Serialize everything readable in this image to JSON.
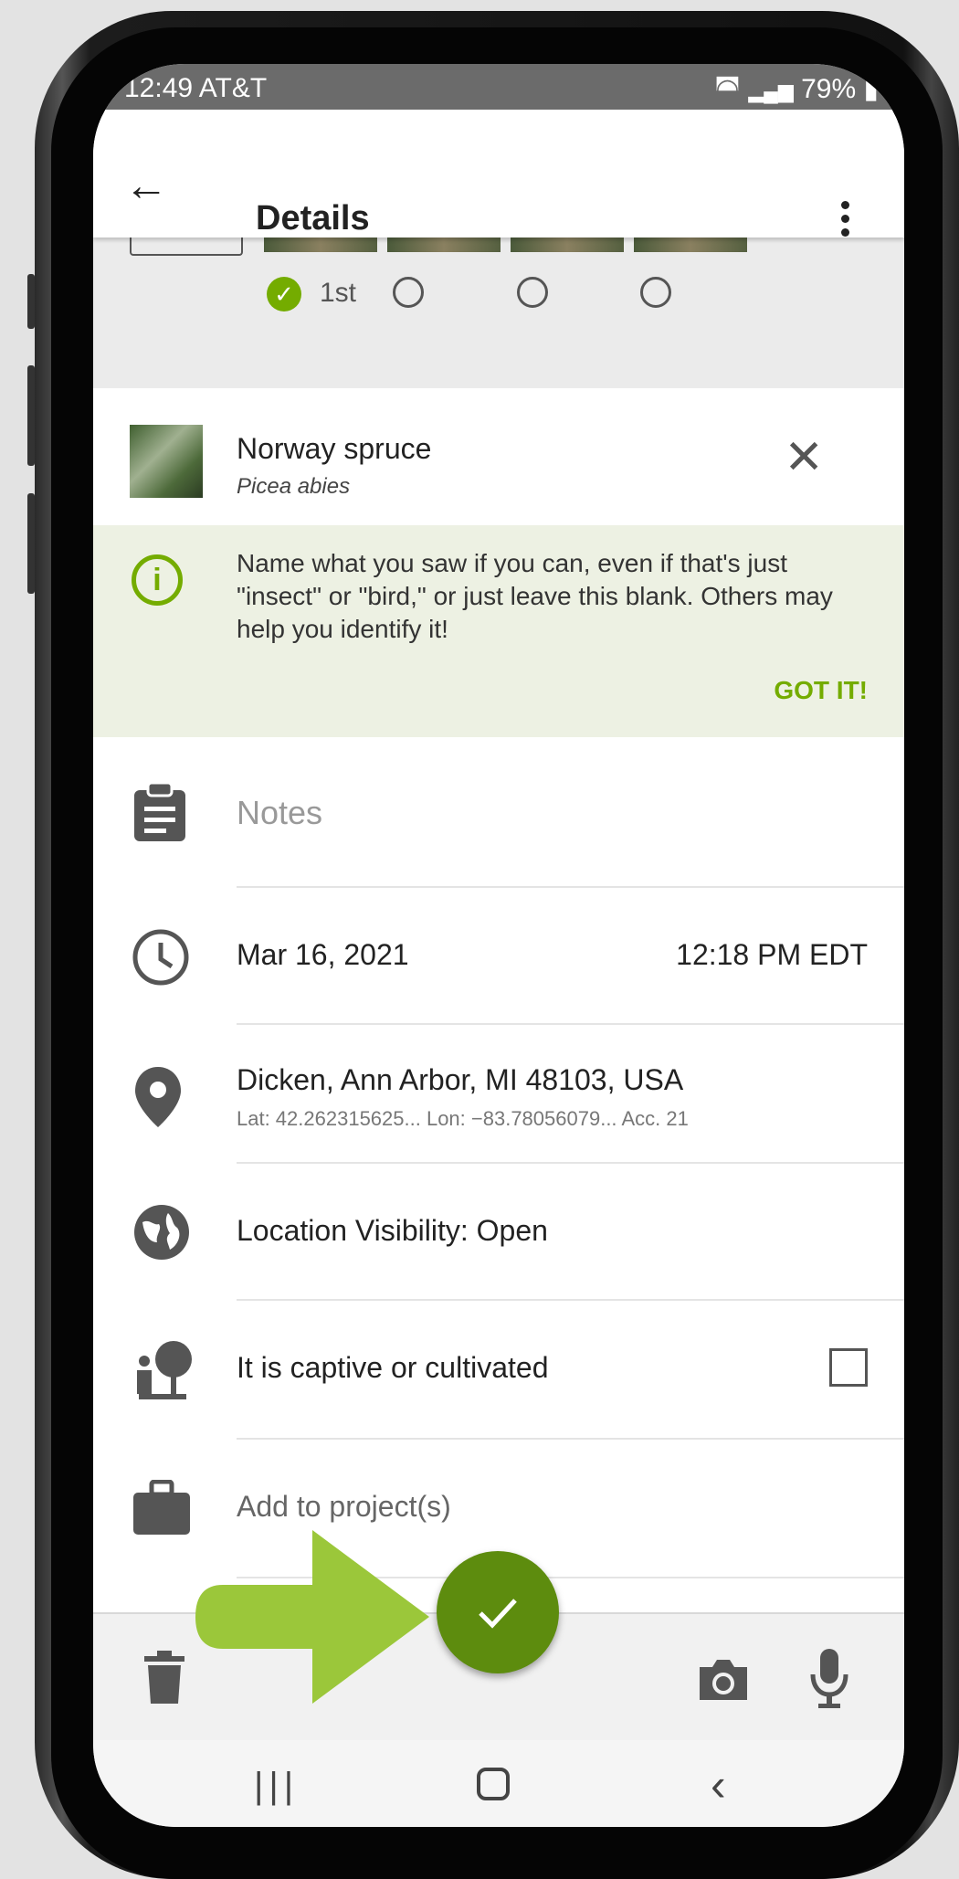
{
  "status_bar": {
    "time": "12:49 AT&T",
    "battery": "79%"
  },
  "app_bar": {
    "title": "Details"
  },
  "photos": {
    "first_label": "1st"
  },
  "species": {
    "common_name": "Norway spruce",
    "scientific_name": "Picea abies"
  },
  "tip": {
    "text": "Name what you saw if you can, even if that's just \"insect\" or \"bird,\" or just leave this blank. Others may help you identify it!",
    "action": "GOT IT!"
  },
  "notes": {
    "placeholder": "Notes"
  },
  "datetime": {
    "date": "Mar 16, 2021",
    "time": "12:18 PM EDT"
  },
  "location": {
    "place": "Dicken, Ann Arbor, MI 48103, USA",
    "details": "Lat: 42.262315625...  Lon: −83.78056079...  Acc. 21"
  },
  "visibility": {
    "label": "Location Visibility: Open"
  },
  "captive": {
    "label": "It is captive or cultivated",
    "checked": false
  },
  "projects": {
    "label": "Add to project(s)"
  },
  "colors": {
    "accent": "#74ac00",
    "fab": "#5d8c0e",
    "arrow": "#9bc73a"
  }
}
